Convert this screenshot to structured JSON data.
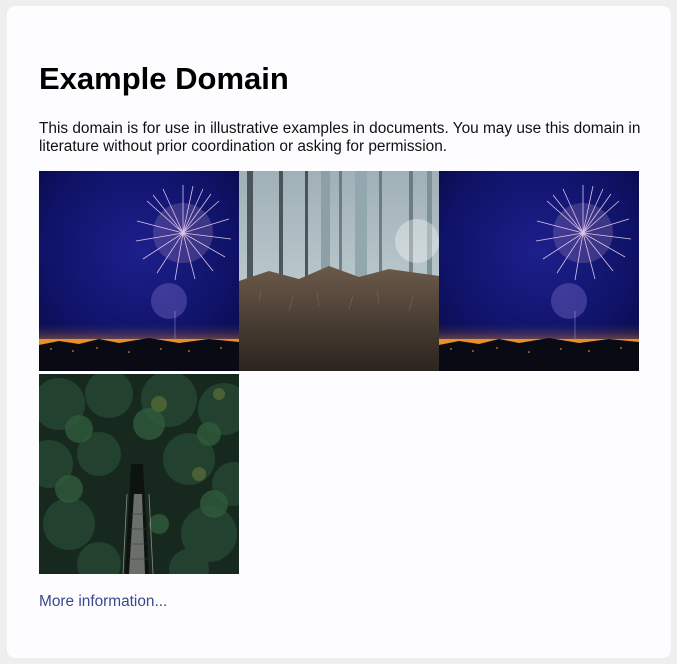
{
  "page": {
    "title": "Example Domain",
    "description": "This domain is for use in illustrative examples in documents. You may use this domain in literature without prior coordination or asking for permission.",
    "link_label": "More information...",
    "link_color": "#38488f"
  },
  "gallery": {
    "images": [
      {
        "name": "fireworks-image",
        "subject": "fireworks over night city"
      },
      {
        "name": "foggy-forest-image",
        "subject": "misty forest with tall trees"
      },
      {
        "name": "fireworks-image",
        "subject": "fireworks over night city"
      },
      {
        "name": "forest-bridge-image",
        "subject": "aerial view of suspension bridge in forest"
      }
    ]
  }
}
